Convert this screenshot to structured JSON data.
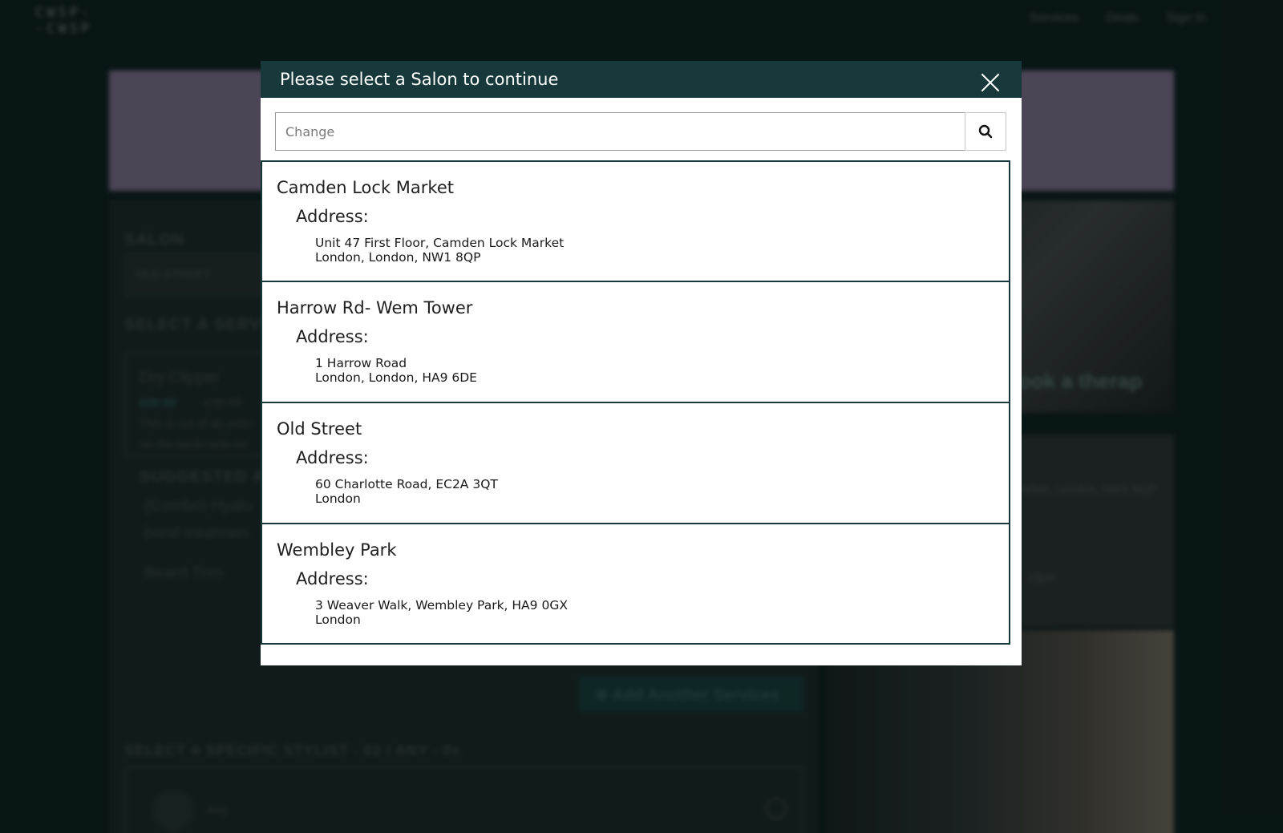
{
  "background": {
    "logo_line1": "CWSP-",
    "logo_line2": "-CWSP",
    "nav": [
      "Services",
      "Deals",
      "Sign In"
    ],
    "salon_label": "SALON",
    "salon_value": "OLD STREET",
    "service_label": "SELECT A SERVICE",
    "service_name": "Dry Clipper",
    "service_price_old": "£00.00",
    "service_price": "£30.00",
    "service_desc_1": "This is cut of an exec",
    "service_desc_2": "on the back/ side on",
    "suggested_label": "SUGGESTED A",
    "suggested_1": "(Combo) Hyalu",
    "suggested_2": "bond treatmen",
    "beard_trim": "Beard Trim",
    "add_service_button": "⊕ Add Another Services",
    "stylist_label": "SELECT A SPECIFIC STYLIST - 02 / ANY - 0x",
    "stylist_any": "Any",
    "side_photo_text": "ook a therap",
    "side_info_address": "Market, London, NW1 8QP",
    "side_info_hours": "10pm"
  },
  "modal": {
    "title": "Please select a Salon to continue",
    "search": {
      "placeholder": "Change",
      "value": ""
    },
    "address_label": "Address:",
    "salons": [
      {
        "name": "Camden Lock Market",
        "address_line1": "Unit 47 First Floor, Camden Lock Market",
        "address_line2": "London, London, NW1 8QP"
      },
      {
        "name": "Harrow Rd- Wem Tower",
        "address_line1": "1 Harrow Road",
        "address_line2": "London, London, HA9 6DE"
      },
      {
        "name": "Old Street",
        "address_line1": "60 Charlotte Road, EC2A 3QT",
        "address_line2": "London"
      },
      {
        "name": "Wembley Park",
        "address_line1": "3 Weaver Walk, Wembley Park, HA9 0GX",
        "address_line2": "London"
      }
    ]
  },
  "colors": {
    "header_bg": "#17393b",
    "page_bg": "#0f2222",
    "hero_bg": "#756a85"
  }
}
